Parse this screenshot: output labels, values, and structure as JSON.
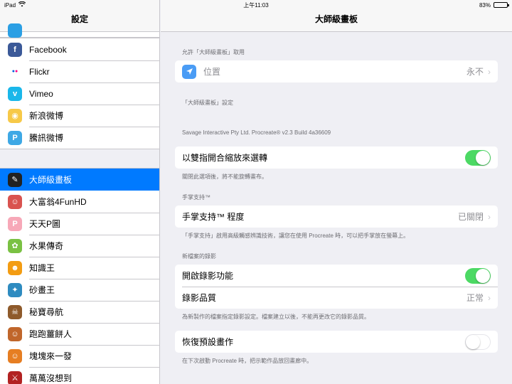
{
  "status_bar": {
    "device": "iPad",
    "time": "上午11:03",
    "battery": "83%",
    "battery_level": 0.83
  },
  "sidebar": {
    "title": "設定",
    "social": [
      {
        "label": "Facebook",
        "icon": "facebook-icon",
        "color": "#3b5998",
        "glyph": "f"
      },
      {
        "label": "Flickr",
        "icon": "flickr-icon",
        "color": "#ffffff",
        "glyph": "●●"
      },
      {
        "label": "Vimeo",
        "icon": "vimeo-icon",
        "color": "#1ab7ea",
        "glyph": "v"
      },
      {
        "label": "新浪微博",
        "icon": "sina-weibo-icon",
        "color": "#f7c948",
        "glyph": "◉"
      },
      {
        "label": "騰訊微博",
        "icon": "tencent-weibo-icon",
        "color": "#3ea8e5",
        "glyph": "P"
      }
    ],
    "apps": [
      {
        "label": "大師級畫板",
        "icon": "procreate-icon",
        "color": "#222222",
        "glyph": "✎",
        "active": true
      },
      {
        "label": "大富翁4FunHD",
        "icon": "monopoly-icon",
        "color": "#d9534f",
        "glyph": "☺"
      },
      {
        "label": "天天P圖",
        "icon": "tiantian-ptu-icon",
        "color": "#f7a8b8",
        "glyph": "P"
      },
      {
        "label": "水果傳奇",
        "icon": "fruit-legend-icon",
        "color": "#7ac143",
        "glyph": "✿"
      },
      {
        "label": "知識王",
        "icon": "knowledge-king-icon",
        "color": "#f39c12",
        "glyph": "☻"
      },
      {
        "label": "砂畫王",
        "icon": "sand-painting-icon",
        "color": "#2e8bc0",
        "glyph": "✦"
      },
      {
        "label": "秘寶尋航",
        "icon": "treasure-voyage-icon",
        "color": "#8e5a2b",
        "glyph": "☠"
      },
      {
        "label": "跑跑薑餅人",
        "icon": "cookie-run-icon",
        "color": "#c0662b",
        "glyph": "☺"
      },
      {
        "label": "塊塊來一發",
        "icon": "blocks-game-icon",
        "color": "#e67e22",
        "glyph": "☺"
      },
      {
        "label": "萬萬沒想到",
        "icon": "wanwan-icon",
        "color": "#b22222",
        "glyph": "⚔"
      }
    ]
  },
  "main": {
    "title": "大師級畫板",
    "allow_header": "允許「大師級畫板」取用",
    "location": {
      "label": "位置",
      "value": "永不"
    },
    "settings_header": "「大師級畫板」設定",
    "version": "Savage Interactive Pty Ltd. Procreate® v2.3 Build 4a36609",
    "pinch": {
      "label": "以雙指開合縮放來選轉",
      "on": true
    },
    "pinch_footer": "關閉此選項後，將不能旋轉畫布。",
    "palm_header": "手掌支持™",
    "palm": {
      "label": "手掌支持™ 程度",
      "value": "已關閉"
    },
    "palm_footer": "「手掌支持」啟用高級觸感辨識技術，讓您在使用 Procreate 時，可以把手掌放在螢幕上。",
    "recording_header": "新檔案的錄影",
    "recording": {
      "label": "開啟錄影功能",
      "on": true
    },
    "quality": {
      "label": "錄影品質",
      "value": "正常"
    },
    "recording_footer": "為新製作的檔案指定錄影設定。檔案建立以後，不能再更改它的錄影品質。",
    "restore": {
      "label": "恢復預設畫作",
      "on": false
    },
    "restore_footer": "在下次啟動 Procreate 時，把示範作品放回畫廊中。"
  }
}
